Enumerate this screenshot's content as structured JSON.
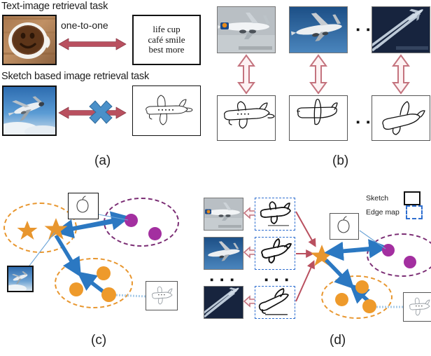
{
  "figure": {
    "panels": [
      {
        "id": "a",
        "label": "(a)"
      },
      {
        "id": "b",
        "label": "(b)"
      },
      {
        "id": "c",
        "label": "(c)"
      },
      {
        "id": "d",
        "label": "(d)"
      }
    ]
  },
  "panel_a": {
    "task1_title": "Text-image retrieval task",
    "task2_title": "Sketch based image retrieval task",
    "relation_label": "one-to-one",
    "text_lines": [
      "life cup",
      "café smile",
      "best more"
    ],
    "coffee_image_alt": "coffee cup with smiley face",
    "plane_image_alt": "airplane photo",
    "plane_sketch_alt": "airplane sketch",
    "mismatch_marker": "x-cross"
  },
  "panel_b": {
    "photos": [
      "lufthansa airliner photo",
      "airliner in blue sky photo",
      "jet with contrails photo"
    ],
    "sketches": [
      "airliner sketch",
      "simple plane sketch",
      "swept-wing plane sketch"
    ],
    "ellipsis": "▪ ▪ ▪",
    "pair_arrow": "double-headed vertical arrow"
  },
  "panel_c": {
    "sketch_thumb_alt": "apple doodle sketch",
    "photo_thumb_alt": "airplane photo thumbnail",
    "sketch_plane_alt": "faint airplane sketch",
    "clusters": [
      {
        "name": "anchor-star-cluster",
        "color": "#E8962E",
        "marker": "star",
        "count": 2
      },
      {
        "name": "purple-dot-cluster",
        "color": "#7B2D74",
        "marker": "dot",
        "count": 2
      },
      {
        "name": "orange-dot-cluster",
        "color": "#E8962E",
        "marker": "dot",
        "count": 3
      }
    ]
  },
  "panel_d": {
    "legend": [
      {
        "label": "Sketch",
        "swatch": "solid-black-box",
        "color": "#111111"
      },
      {
        "label": "Edge map",
        "swatch": "blue-dashdot-box",
        "color": "#2F6FD0"
      }
    ],
    "photos": [
      "lufthansa airliner photo",
      "airliner in blue sky photo",
      "jet with contrails photo"
    ],
    "edge_maps": [
      "airliner edge map",
      "plane edge map",
      "contrail jet edge map"
    ],
    "ellipsis": "▪ ▪ ▪",
    "sketch_thumb_alt": "apple doodle sketch",
    "sketch_plane_alt": "faint airplane sketch",
    "clusters": [
      {
        "name": "fused-anchor-star",
        "color": "#E8962E",
        "marker": "star",
        "count": 1
      },
      {
        "name": "purple-dot-cluster",
        "color": "#7B2D74",
        "marker": "dot",
        "count": 2
      },
      {
        "name": "orange-dot-cluster",
        "color": "#E8962E",
        "marker": "dot",
        "count": 3
      }
    ]
  },
  "colors": {
    "arrow_red": "#B9505F",
    "arrow_red_outline": "#C4737E",
    "arrow_blue": "#2B78C2",
    "cross_blue": "#4A90C9",
    "orange": "#E8962E",
    "purple": "#7B2D74",
    "magenta": "#A32FA0",
    "edge_blue": "#2F6FD0"
  }
}
